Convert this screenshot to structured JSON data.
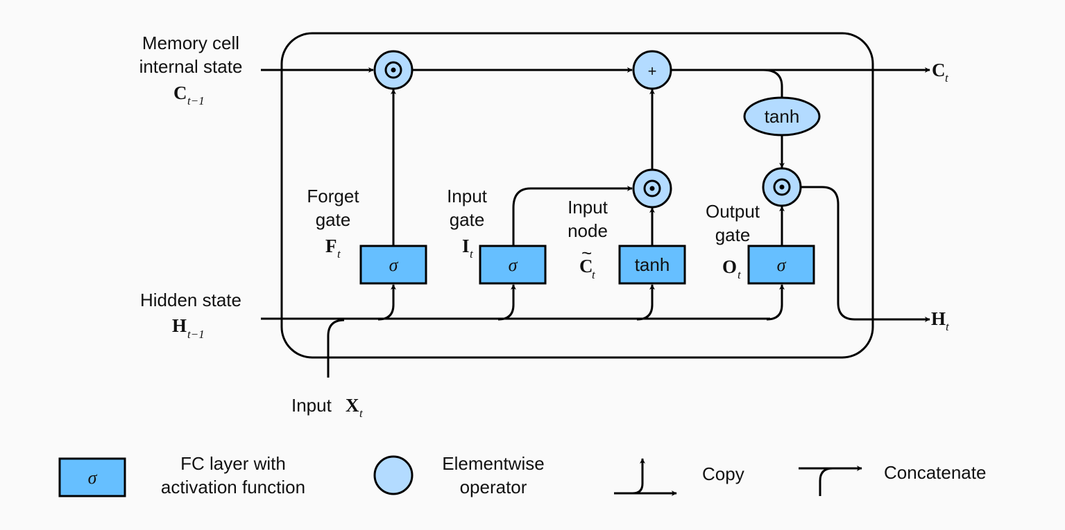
{
  "colors": {
    "fc_layer": "#66bfff",
    "elementwise": "#b3dbff",
    "background": "#fafafa",
    "lines": "#000000"
  },
  "inputs": {
    "memory_cell": {
      "line1": "Memory cell",
      "line2": "internal state",
      "symbol": "C",
      "subscript": "t−1"
    },
    "hidden_state": {
      "label": "Hidden state",
      "symbol": "H",
      "subscript": "t−1"
    },
    "input": {
      "label": "Input",
      "symbol": "X",
      "subscript": "t"
    }
  },
  "outputs": {
    "cell": {
      "symbol": "C",
      "subscript": "t"
    },
    "hidden": {
      "symbol": "H",
      "subscript": "t"
    }
  },
  "gates": {
    "forget": {
      "line1": "Forget",
      "line2": "gate",
      "symbol": "F",
      "subscript": "t",
      "activation": "σ"
    },
    "input": {
      "line1": "Input",
      "line2": "gate",
      "symbol": "I",
      "subscript": "t",
      "activation": "σ"
    },
    "node": {
      "line1": "Input",
      "line2": "node",
      "symbol": "C",
      "tilde": "~",
      "subscript": "t",
      "activation": "tanh"
    },
    "output": {
      "line1": "Output",
      "line2": "gate",
      "symbol": "O",
      "subscript": "t",
      "activation": "σ"
    }
  },
  "operators": {
    "multiply": "⊙",
    "add": "+",
    "cell_tanh": "tanh"
  },
  "legend": {
    "fc": {
      "symbol": "σ",
      "line1": "FC layer with",
      "line2": "activation function"
    },
    "elementwise": {
      "line1": "Elementwise",
      "line2": "operator"
    },
    "copy": {
      "label": "Copy"
    },
    "concatenate": {
      "label": "Concatenate"
    }
  }
}
